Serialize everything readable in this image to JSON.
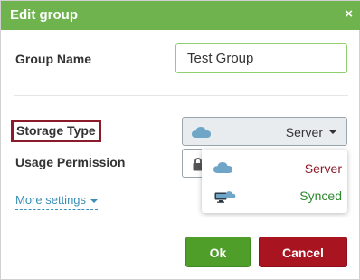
{
  "dialog": {
    "title": "Edit group",
    "close_glyph": "×"
  },
  "group_name": {
    "label": "Group Name",
    "value": "Test Group"
  },
  "storage_type": {
    "label": "Storage Type",
    "selected": "Server",
    "options": [
      {
        "label": "Server",
        "icon": "cloud-icon",
        "color": "#8b1a2a"
      },
      {
        "label": "Synced",
        "icon": "monitor-cloud-icon",
        "color": "#2f8a2f"
      }
    ]
  },
  "usage_permission": {
    "label": "Usage Permission",
    "icon": "lock-icon"
  },
  "more_settings": {
    "label": "More settings"
  },
  "buttons": {
    "ok": "Ok",
    "cancel": "Cancel"
  },
  "colors": {
    "titlebar": "#6fb34f",
    "ok": "#4f9e2a",
    "cancel": "#a8141f",
    "link": "#3a8fb7",
    "cloud": "#6fa6c7"
  }
}
